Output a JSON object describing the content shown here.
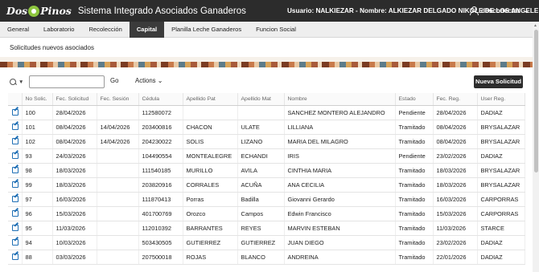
{
  "header": {
    "logo_text_left": "Dos",
    "logo_text_right": "Pinos",
    "app_title": "Sistema Integrado Asociados Ganaderos",
    "user_info": "Usuario: NALKIEZAR - Nombre: ALKIEZAR DELGADO NIKOLE DE LOS ANGELE",
    "logout_label": "desconectar"
  },
  "nav": {
    "tabs": [
      {
        "label": "General"
      },
      {
        "label": "Laboratorio"
      },
      {
        "label": "Recolección"
      },
      {
        "label": "Capital"
      },
      {
        "label": "Planilla Leche Ganaderos"
      },
      {
        "label": "Funcion Social"
      }
    ],
    "active": "Capital"
  },
  "region": {
    "title": "Solicitudes nuevos asociados"
  },
  "toolbar": {
    "search_value": "",
    "go_label": "Go",
    "actions_label": "Actions",
    "new_button_label": "Nueva Solicitud"
  },
  "table": {
    "headers": [
      "",
      "No Solic.",
      "Fec. Solicitud",
      "Fec. Sesión",
      "Cédula",
      "Apellido Pat",
      "Apellido Mat",
      "Nombre",
      "Estado",
      "Fec. Reg.",
      "User Reg."
    ],
    "rows": [
      [
        "100",
        "28/04/2026",
        "",
        "112580072",
        "",
        "",
        "SANCHEZ MONTERO ALEJANDRO",
        "Pendiente",
        "28/04/2026",
        "DADIAZ"
      ],
      [
        "101",
        "08/04/2026",
        "14/04/2026",
        "203400816",
        "CHACON",
        "ULATE",
        "LILLIANA",
        "Tramitado",
        "08/04/2026",
        "BRYSALAZAR"
      ],
      [
        "102",
        "08/04/2026",
        "14/04/2026",
        "204230022",
        "SOLIS",
        "LIZANO",
        "MARIA DEL MILAGRO",
        "Tramitado",
        "08/04/2026",
        "BRYSALAZAR"
      ],
      [
        "93",
        "24/03/2026",
        "",
        "104490554",
        "MONTEALEGRE",
        "ECHANDI",
        "IRIS",
        "Pendiente",
        "23/02/2026",
        "DADIAZ"
      ],
      [
        "98",
        "18/03/2026",
        "",
        "111540185",
        "MURILLO",
        "AVILA",
        "CINTHIA MARIA",
        "Tramitado",
        "18/03/2026",
        "BRYSALAZAR"
      ],
      [
        "99",
        "18/03/2026",
        "",
        "203820916",
        "CORRALES",
        "ACUÑA",
        "ANA CECILIA",
        "Tramitado",
        "18/03/2026",
        "BRYSALAZAR"
      ],
      [
        "97",
        "16/03/2026",
        "",
        "111870413",
        "Porras",
        "Badilla",
        "Giovanni Gerardo",
        "Tramitado",
        "16/03/2026",
        "CARPORRAS"
      ],
      [
        "96",
        "15/03/2026",
        "",
        "401700769",
        "Orozco",
        "Campos",
        "Edwin Francisco",
        "Tramitado",
        "15/03/2026",
        "CARPORRAS"
      ],
      [
        "95",
        "11/03/2026",
        "",
        "112010392",
        "BARRANTES",
        "REYES",
        "MARVIN ESTEBAN",
        "Tramitado",
        "11/03/2026",
        "STARCE"
      ],
      [
        "94",
        "10/03/2026",
        "",
        "503430505",
        "GUTIERREZ",
        "GUTIERREZ",
        "JUAN DIEGO",
        "Tramitado",
        "23/02/2026",
        "DADIAZ"
      ],
      [
        "88",
        "03/03/2026",
        "",
        "207500018",
        "ROJAS",
        "BLANCO",
        "ANDREINA",
        "Tramitado",
        "22/01/2026",
        "DADIAZ"
      ]
    ]
  },
  "colors": {
    "topbar": "#2c2c2c",
    "active_tab": "#3b3b3b",
    "button": "#2d2d2d",
    "edit_icon": "#1f6fb5"
  }
}
